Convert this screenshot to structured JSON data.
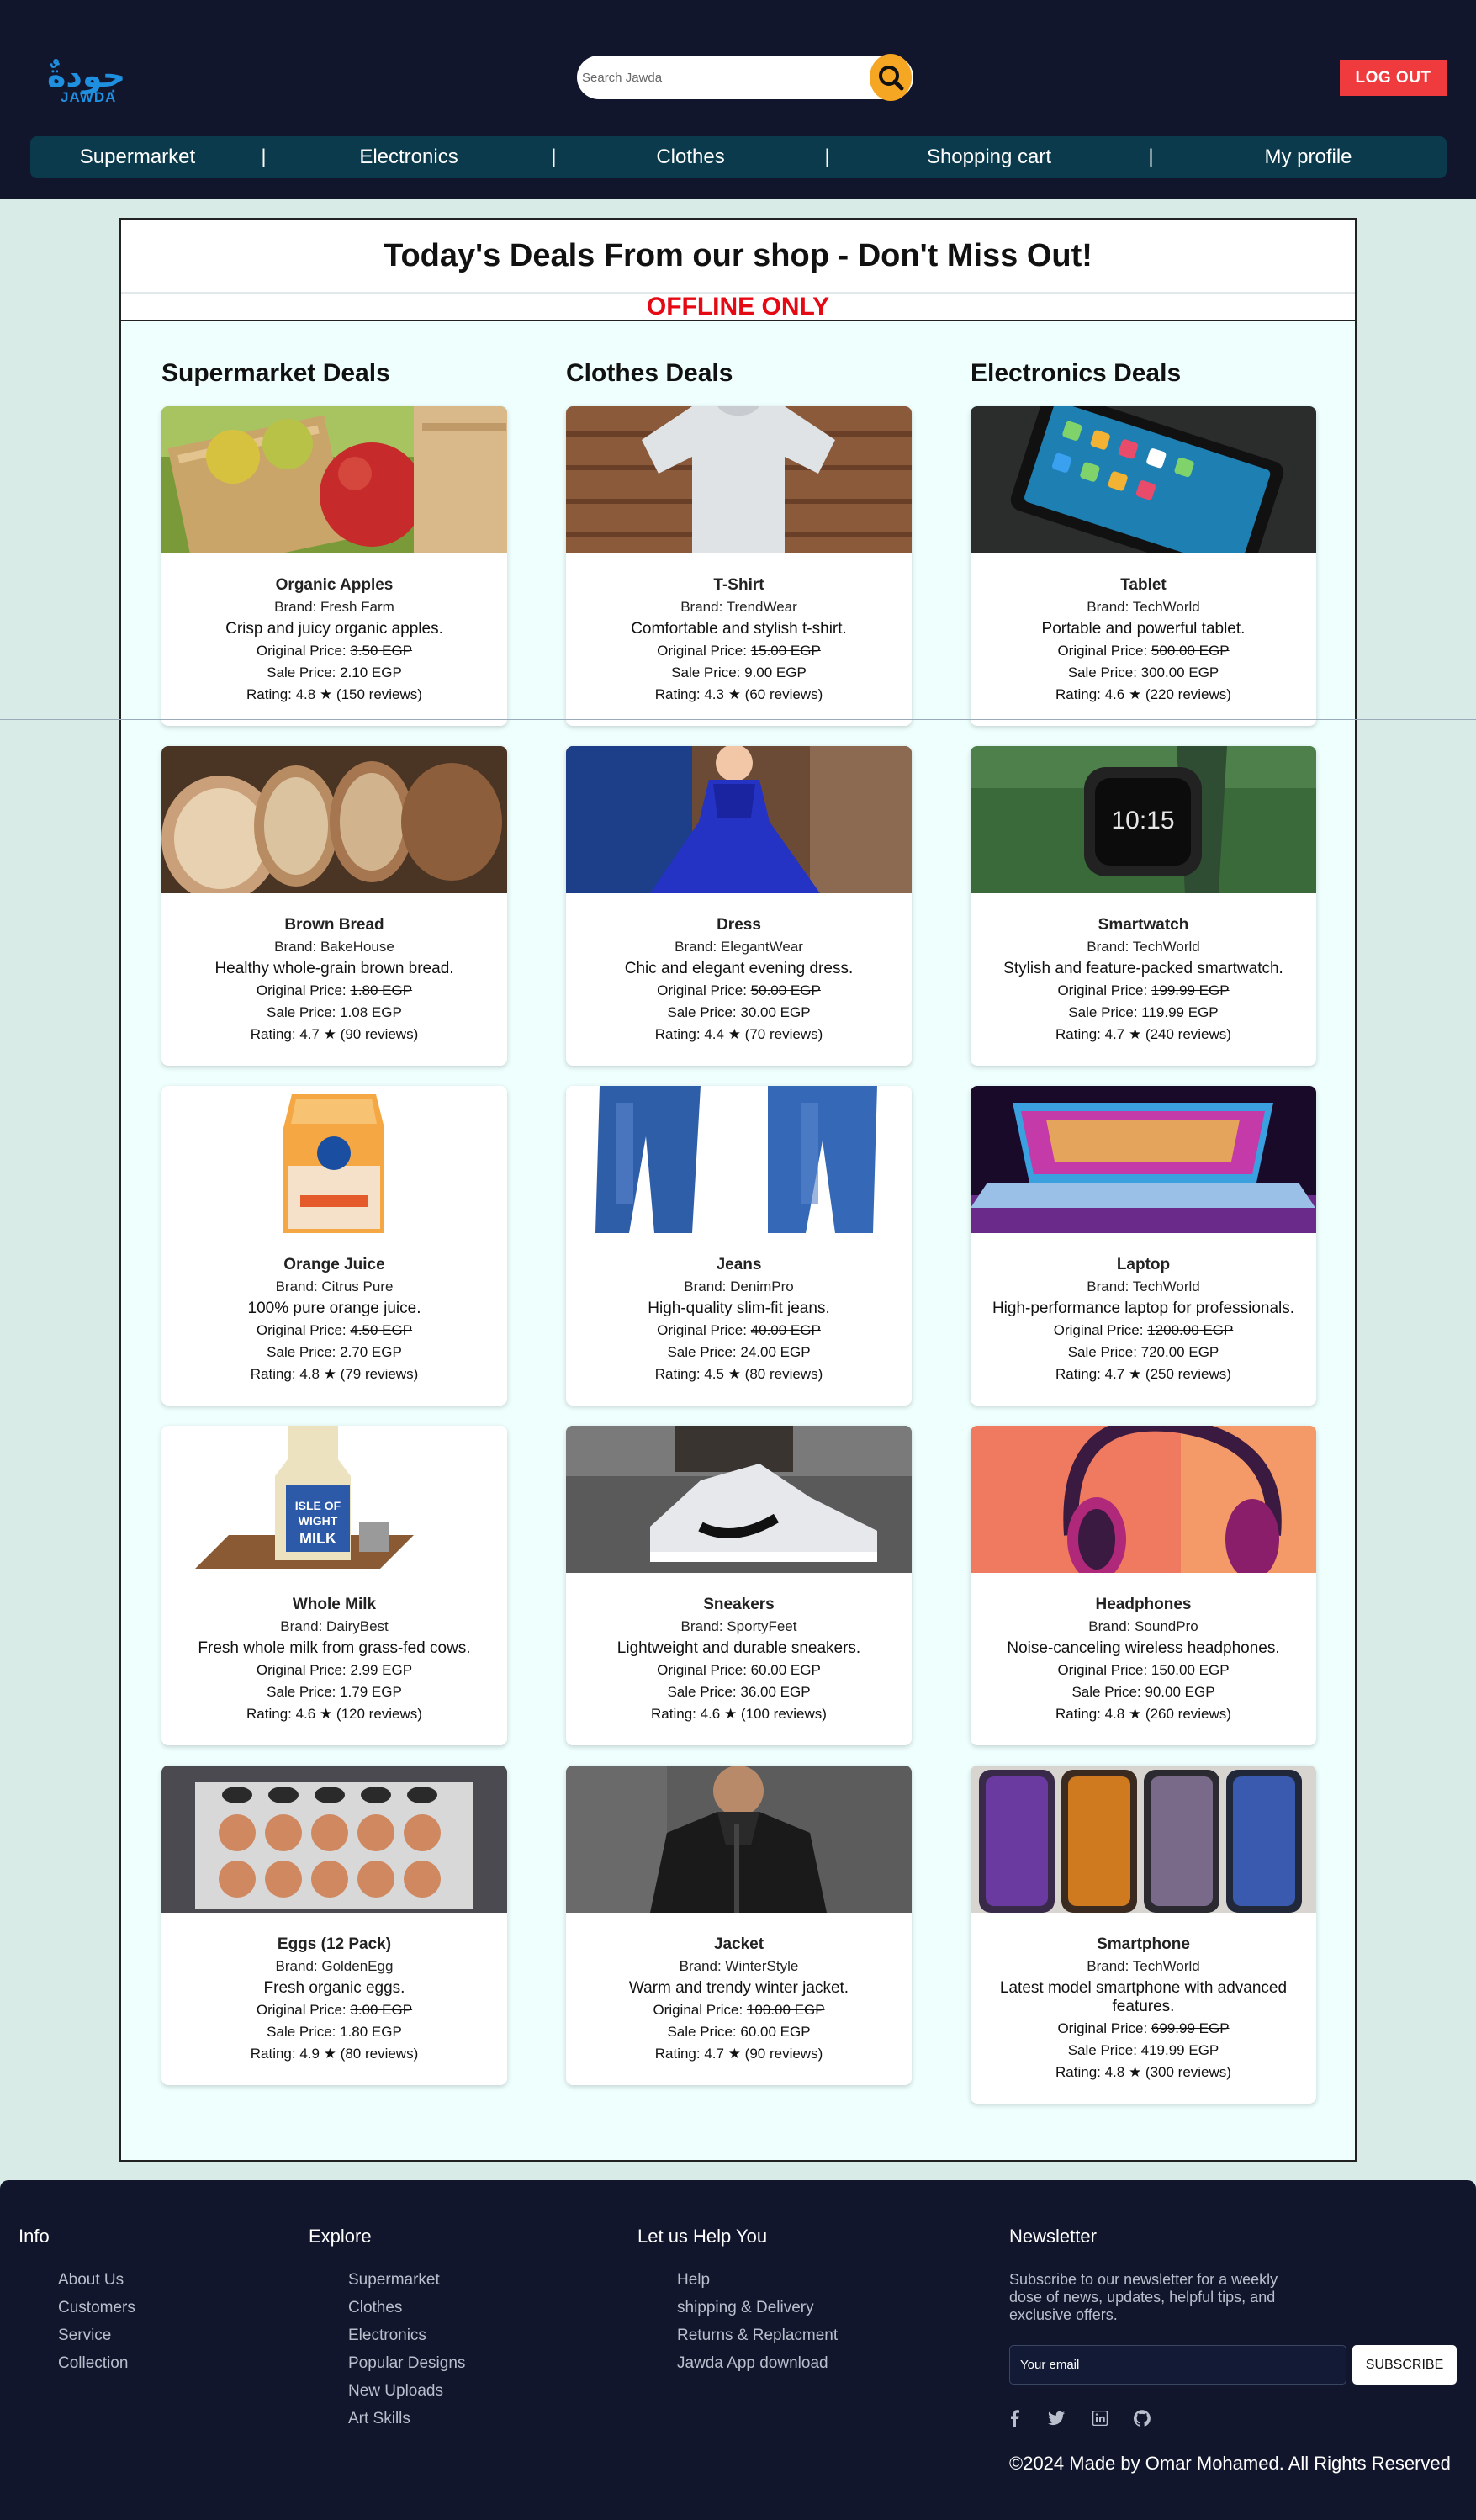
{
  "header": {
    "logo_arabic": "جودةٌ",
    "logo_text": "JAWDA",
    "search_placeholder": "Search Jawda",
    "logout_label": "LOG OUT"
  },
  "nav": {
    "items": [
      "Supermarket",
      "Electronics",
      "Clothes",
      "Shopping cart",
      "My profile"
    ],
    "separator": "|"
  },
  "deals": {
    "title": "Today's Deals From our shop - Don't Miss Out!",
    "subtitle": "OFFLINE ONLY",
    "columns": [
      {
        "title": "Supermarket Deals",
        "products": [
          {
            "name": "Organic Apples",
            "brand": "Brand: Fresh Farm",
            "desc": "Crisp and juicy organic apples.",
            "orig_label": "Original Price: ",
            "orig": "3.50 EGP",
            "sale": "Sale Price: 2.10 EGP",
            "rating": "Rating: 4.8 ★ (150 reviews)"
          },
          {
            "name": "Brown Bread",
            "brand": "Brand: BakeHouse",
            "desc": "Healthy whole-grain brown bread.",
            "orig_label": "Original Price: ",
            "orig": "1.80 EGP",
            "sale": "Sale Price: 1.08 EGP",
            "rating": "Rating: 4.7 ★ (90 reviews)"
          },
          {
            "name": "Orange Juice",
            "brand": "Brand: Citrus Pure",
            "desc": "100% pure orange juice.",
            "orig_label": "Original Price: ",
            "orig": "4.50 EGP",
            "sale": "Sale Price: 2.70 EGP",
            "rating": "Rating: 4.8 ★ (79 reviews)"
          },
          {
            "name": "Whole Milk",
            "brand": "Brand: DairyBest",
            "desc": "Fresh whole milk from grass-fed cows.",
            "orig_label": "Original Price: ",
            "orig": "2.99 EGP",
            "sale": "Sale Price: 1.79 EGP",
            "rating": "Rating: 4.6 ★ (120 reviews)"
          },
          {
            "name": "Eggs (12 Pack)",
            "brand": "Brand: GoldenEgg",
            "desc": "Fresh organic eggs.",
            "orig_label": "Original Price: ",
            "orig": "3.00 EGP",
            "sale": "Sale Price: 1.80 EGP",
            "rating": "Rating: 4.9 ★ (80 reviews)"
          }
        ]
      },
      {
        "title": "Clothes Deals",
        "products": [
          {
            "name": "T-Shirt",
            "brand": "Brand: TrendWear",
            "desc": "Comfortable and stylish t-shirt.",
            "orig_label": "Original Price: ",
            "orig": "15.00 EGP",
            "sale": "Sale Price: 9.00 EGP",
            "rating": "Rating: 4.3 ★ (60 reviews)"
          },
          {
            "name": "Dress",
            "brand": "Brand: ElegantWear",
            "desc": "Chic and elegant evening dress.",
            "orig_label": "Original Price: ",
            "orig": "50.00 EGP",
            "sale": "Sale Price: 30.00 EGP",
            "rating": "Rating: 4.4 ★ (70 reviews)"
          },
          {
            "name": "Jeans",
            "brand": "Brand: DenimPro",
            "desc": "High-quality slim-fit jeans.",
            "orig_label": "Original Price: ",
            "orig": "40.00 EGP",
            "sale": "Sale Price: 24.00 EGP",
            "rating": "Rating: 4.5 ★ (80 reviews)"
          },
          {
            "name": "Sneakers",
            "brand": "Brand: SportyFeet",
            "desc": "Lightweight and durable sneakers.",
            "orig_label": "Original Price: ",
            "orig": "60.00 EGP",
            "sale": "Sale Price: 36.00 EGP",
            "rating": "Rating: 4.6 ★ (100 reviews)"
          },
          {
            "name": "Jacket",
            "brand": "Brand: WinterStyle",
            "desc": "Warm and trendy winter jacket.",
            "orig_label": "Original Price: ",
            "orig": "100.00 EGP",
            "sale": "Sale Price: 60.00 EGP",
            "rating": "Rating: 4.7 ★ (90 reviews)"
          }
        ]
      },
      {
        "title": "Electronics Deals",
        "products": [
          {
            "name": "Tablet",
            "brand": "Brand: TechWorld",
            "desc": "Portable and powerful tablet.",
            "orig_label": "Original Price: ",
            "orig": "500.00 EGP",
            "sale": "Sale Price: 300.00 EGP",
            "rating": "Rating: 4.6 ★ (220 reviews)"
          },
          {
            "name": "Smartwatch",
            "brand": "Brand: TechWorld",
            "desc": "Stylish and feature-packed smartwatch.",
            "orig_label": "Original Price: ",
            "orig": "199.99 EGP",
            "sale": "Sale Price: 119.99 EGP",
            "rating": "Rating: 4.7 ★ (240 reviews)"
          },
          {
            "name": "Laptop",
            "brand": "Brand: TechWorld",
            "desc": "High-performance laptop for professionals.",
            "orig_label": "Original Price: ",
            "orig": "1200.00 EGP",
            "sale": "Sale Price: 720.00 EGP",
            "rating": "Rating: 4.7 ★ (250 reviews)"
          },
          {
            "name": "Headphones",
            "brand": "Brand: SoundPro",
            "desc": "Noise-canceling wireless headphones.",
            "orig_label": "Original Price: ",
            "orig": "150.00 EGP",
            "sale": "Sale Price: 90.00 EGP",
            "rating": "Rating: 4.8 ★ (260 reviews)"
          },
          {
            "name": "Smartphone",
            "brand": "Brand: TechWorld",
            "desc": "Latest model smartphone with advanced features.",
            "orig_label": "Original Price: ",
            "orig": "699.99 EGP",
            "sale": "Sale Price: 419.99 EGP",
            "rating": "Rating: 4.8 ★ (300 reviews)"
          }
        ]
      }
    ]
  },
  "footer": {
    "info": {
      "title": "Info",
      "links": [
        "About Us",
        "Customers",
        "Service",
        "Collection"
      ]
    },
    "explore": {
      "title": "Explore",
      "links": [
        "Supermarket",
        "Clothes",
        "Electronics",
        "Popular Designs",
        "New Uploads",
        "Art Skills"
      ]
    },
    "help": {
      "title": "Let us Help You",
      "links": [
        "Help",
        "shipping & Delivery",
        "Returns & Replacment",
        "Jawda App download"
      ]
    },
    "newsletter": {
      "title": "Newsletter",
      "text": "Subscribe to our newsletter for a weekly dose of news, updates, helpful tips, and exclusive offers.",
      "email_placeholder": "Your email",
      "subscribe_label": "SUBSCRIBE"
    },
    "social_icons": [
      "facebook-icon",
      "twitter-icon",
      "linkedin-icon",
      "github-icon"
    ],
    "copyright": "©2024 Made by Omar Mohamed. All Rights Reserved"
  }
}
